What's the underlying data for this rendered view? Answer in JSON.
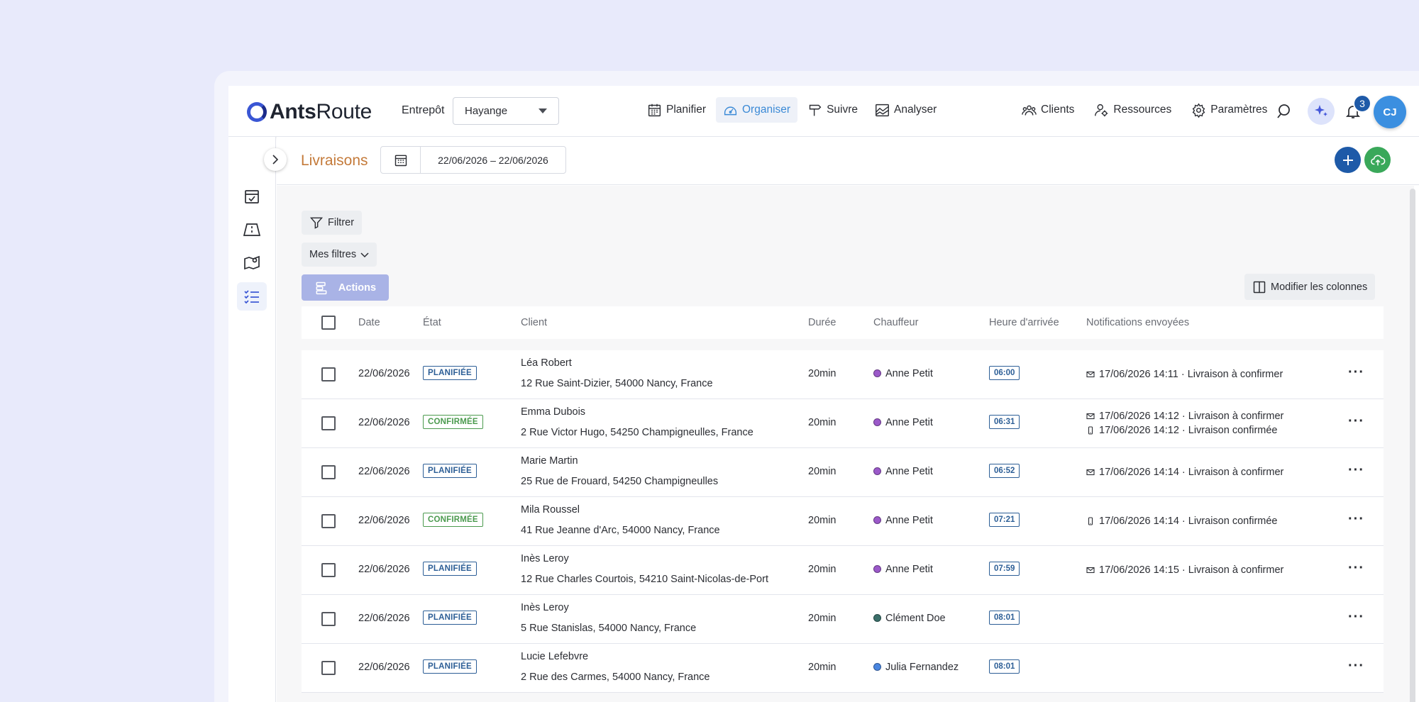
{
  "app": {
    "logo_prefix": "Ants",
    "logo_suffix": "Route",
    "warehouse_label": "Entrepôt",
    "warehouse_value": "Hayange"
  },
  "nav": [
    {
      "label": "Planifier",
      "icon": "calendar-icon",
      "active": false
    },
    {
      "label": "Organiser",
      "icon": "dashboard-icon",
      "active": true
    },
    {
      "label": "Suivre",
      "icon": "signpost-icon",
      "active": false
    },
    {
      "label": "Analyser",
      "icon": "chart-icon",
      "active": false
    }
  ],
  "nav_right": [
    {
      "label": "Clients",
      "icon": "users-icon"
    },
    {
      "label": "Ressources",
      "icon": "user-gear-icon"
    },
    {
      "label": "Paramètres",
      "icon": "gear-icon"
    }
  ],
  "notifications_count": "3",
  "avatar_initials": "CJ",
  "page": {
    "title": "Livraisons",
    "date_range": "22/06/2026 – 22/06/2026"
  },
  "toolbar": {
    "filter_label": "Filtrer",
    "my_filters_label": "Mes filtres",
    "actions_label": "Actions",
    "modify_columns_label": "Modifier les colonnes"
  },
  "columns": {
    "date": "Date",
    "state": "État",
    "client": "Client",
    "duration": "Durée",
    "driver": "Chauffeur",
    "arrival": "Heure d'arrivée",
    "notifications": "Notifications envoyées"
  },
  "colors": {
    "accent": "#3b8ad6",
    "primary_dark": "#1e5aa8",
    "title": "#c47a3a",
    "planned": "#2c5e96",
    "confirmed": "#4b9a4e",
    "cloud_button": "#3aa85a",
    "driver_anne": "#9b59c9",
    "driver_clement": "#3b6f6a",
    "driver_julia": "#4a86e0"
  },
  "rows": [
    {
      "date": "22/06/2026",
      "state": "PLANIFIÉE",
      "state_type": "plan",
      "client_name": "Léa Robert",
      "client_address": "12 Rue Saint-Dizier, 54000 Nancy, France",
      "duration": "20min",
      "driver": "Anne Petit",
      "driver_color": "#9b59c9",
      "arrival": "06:00",
      "notifications": [
        {
          "icon": "mail-icon",
          "text": "17/06/2026 14:11 · Livraison à confirmer"
        }
      ]
    },
    {
      "date": "22/06/2026",
      "state": "CONFIRMÉE",
      "state_type": "conf",
      "client_name": "Emma Dubois",
      "client_address": "2 Rue Victor Hugo, 54250 Champigneulles, France",
      "duration": "20min",
      "driver": "Anne Petit",
      "driver_color": "#9b59c9",
      "arrival": "06:31",
      "notifications": [
        {
          "icon": "mail-icon",
          "text": "17/06/2026 14:12 · Livraison à confirmer"
        },
        {
          "icon": "phone-icon",
          "text": "17/06/2026 14:12 · Livraison confirmée"
        }
      ]
    },
    {
      "date": "22/06/2026",
      "state": "PLANIFIÉE",
      "state_type": "plan",
      "client_name": "Marie Martin",
      "client_address": "25 Rue de Frouard, 54250 Champigneulles",
      "duration": "20min",
      "driver": "Anne Petit",
      "driver_color": "#9b59c9",
      "arrival": "06:52",
      "notifications": [
        {
          "icon": "mail-icon",
          "text": "17/06/2026 14:14 · Livraison à confirmer"
        }
      ]
    },
    {
      "date": "22/06/2026",
      "state": "CONFIRMÉE",
      "state_type": "conf",
      "client_name": "Mila Roussel",
      "client_address": "41 Rue Jeanne d'Arc, 54000 Nancy, France",
      "duration": "20min",
      "driver": "Anne Petit",
      "driver_color": "#9b59c9",
      "arrival": "07:21",
      "notifications": [
        {
          "icon": "phone-icon",
          "text": "17/06/2026 14:14 · Livraison confirmée"
        }
      ]
    },
    {
      "date": "22/06/2026",
      "state": "PLANIFIÉE",
      "state_type": "plan",
      "client_name": "Inès Leroy",
      "client_address": "12 Rue Charles Courtois, 54210 Saint-Nicolas-de-Port",
      "duration": "20min",
      "driver": "Anne Petit",
      "driver_color": "#9b59c9",
      "arrival": "07:59",
      "notifications": [
        {
          "icon": "mail-icon",
          "text": "17/06/2026 14:15 · Livraison à confirmer"
        }
      ]
    },
    {
      "date": "22/06/2026",
      "state": "PLANIFIÉE",
      "state_type": "plan",
      "client_name": "Inès Leroy",
      "client_address": "5 Rue Stanislas, 54000 Nancy, France",
      "duration": "20min",
      "driver": "Clément Doe",
      "driver_color": "#3b6f6a",
      "arrival": "08:01",
      "notifications": []
    },
    {
      "date": "22/06/2026",
      "state": "PLANIFIÉE",
      "state_type": "plan",
      "client_name": "Lucie Lefebvre",
      "client_address": "2 Rue des Carmes, 54000 Nancy, France",
      "duration": "20min",
      "driver": "Julia Fernandez",
      "driver_color": "#4a86e0",
      "arrival": "08:01",
      "notifications": []
    }
  ]
}
